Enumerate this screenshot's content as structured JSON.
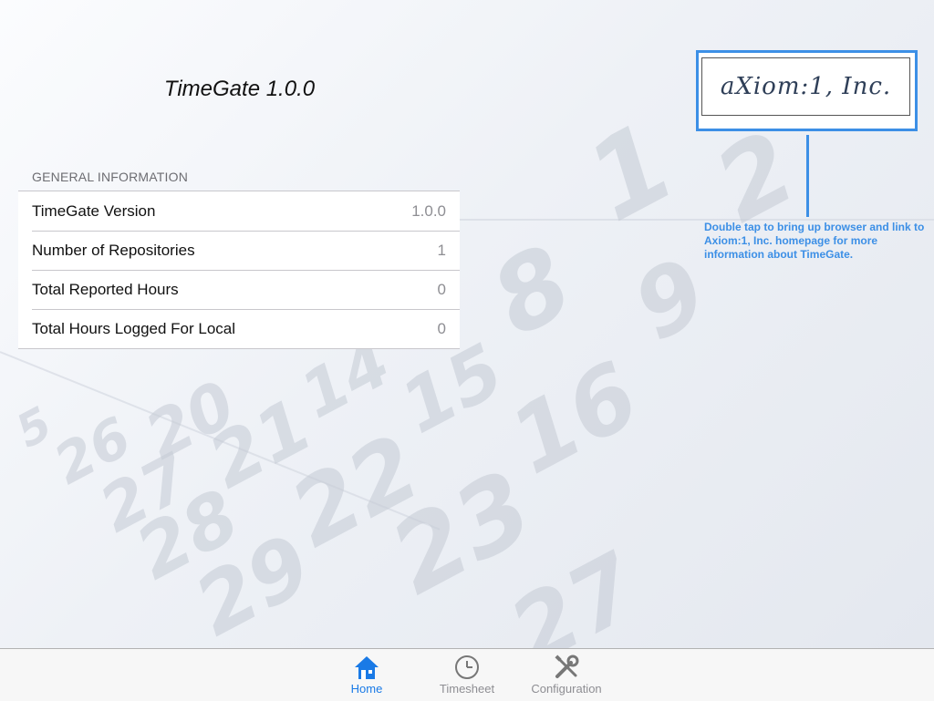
{
  "header": {
    "title": "TimeGate 1.0.0"
  },
  "general_information": {
    "section_title": "GENERAL INFORMATION",
    "rows": [
      {
        "label": "TimeGate Version",
        "value": "1.0.0"
      },
      {
        "label": "Number of Repositories",
        "value": "1"
      },
      {
        "label": "Total Reported Hours",
        "value": "0"
      },
      {
        "label": "Total Hours Logged For Local",
        "value": "0"
      }
    ]
  },
  "logo": {
    "text": "aXiom:1, Inc."
  },
  "hint": {
    "text": "Double tap to bring up browser and link to Axiom:1, Inc. homepage for more information about TimeGate."
  },
  "tabbar": {
    "tabs": [
      {
        "label": "Home",
        "icon": "house-icon",
        "active": true
      },
      {
        "label": "Timesheet",
        "icon": "clock-icon",
        "active": false
      },
      {
        "label": "Configuration",
        "icon": "wrench-screwdriver-icon",
        "active": false
      }
    ]
  },
  "colors": {
    "accent": "#1a7ae6",
    "hint_blue": "#3c8fe6"
  }
}
